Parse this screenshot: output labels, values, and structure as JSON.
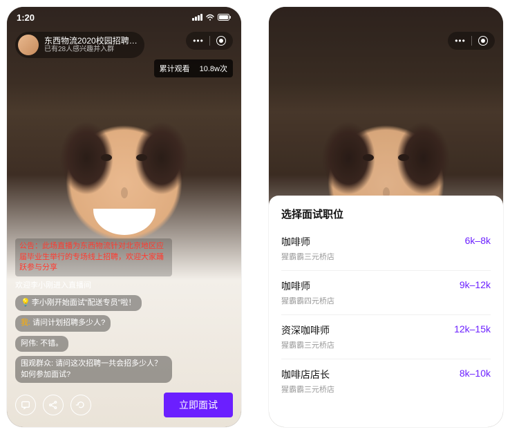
{
  "status": {
    "time": "1:20"
  },
  "header": {
    "title": "东西物流2020校园招聘…",
    "subtitle": "已有28人感兴趣并入群"
  },
  "view_badge": {
    "label": "累计观看",
    "count": "10.8w次"
  },
  "comments": {
    "announcement": "公告：此场直播为东西物流针对北京地区应届毕业生举行的专场线上招聘，欢迎大家踊跃参与分享",
    "c1": "欢迎李小刚进入直播间",
    "c2_prefix": "💡",
    "c2": "李小刚开始面试\"配送专员\"啦！",
    "c3_prefix": "我:",
    "c3": "请问计划招聘多少人?",
    "c4": "阿伟: 不错。",
    "c5": "围观群众:  请问这次招聘一共会招多少人？如何参加面试?"
  },
  "primary_button": "立即面试",
  "sheet": {
    "title": "选择面试职位",
    "jobs": [
      {
        "name": "咖啡师",
        "store": "猩霸霸三元桥店",
        "salary": "6k–8k"
      },
      {
        "name": "咖啡师",
        "store": "猩霸霸四元桥店",
        "salary": "9k–12k"
      },
      {
        "name": "资深咖啡师",
        "store": "猩霸霸三元桥店",
        "salary": "12k–15k"
      },
      {
        "name": "咖啡店店长",
        "store": "猩霸霸三元桥店",
        "salary": "8k–10k"
      }
    ]
  }
}
